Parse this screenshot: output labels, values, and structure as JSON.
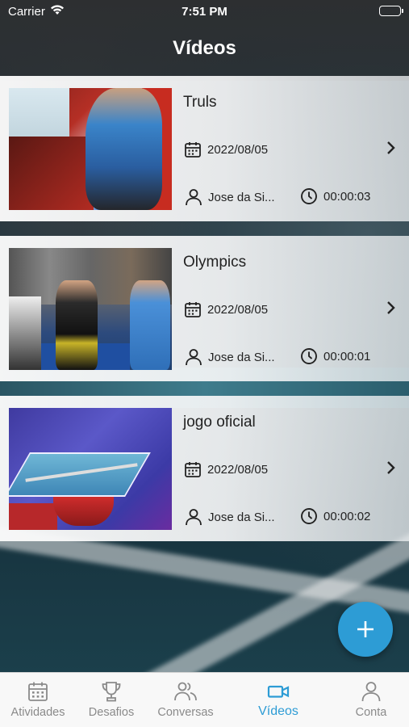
{
  "status_bar": {
    "carrier": "Carrier",
    "time": "7:51 PM"
  },
  "header": {
    "title": "Vídeos"
  },
  "videos": [
    {
      "title": "Truls",
      "date": "2022/08/05",
      "user": "Jose da Si...",
      "duration": "00:00:03"
    },
    {
      "title": "Olympics",
      "date": "2022/08/05",
      "user": "Jose da Si...",
      "duration": "00:00:01"
    },
    {
      "title": "jogo oficial",
      "date": "2022/08/05",
      "user": "Jose da Si...",
      "duration": "00:00:02"
    }
  ],
  "fab": {
    "icon": "plus-icon"
  },
  "tab_bar": {
    "tabs": [
      {
        "label": "Atividades",
        "icon": "calendar-icon"
      },
      {
        "label": "Desafios",
        "icon": "trophy-icon"
      },
      {
        "label": "Conversas",
        "icon": "users-icon"
      },
      {
        "label": "Vídeos",
        "icon": "video-icon"
      },
      {
        "label": "Conta",
        "icon": "person-icon"
      }
    ],
    "active_index": 3
  },
  "colors": {
    "accent": "#2d9cd5",
    "tab_inactive": "#8a8a8a"
  }
}
